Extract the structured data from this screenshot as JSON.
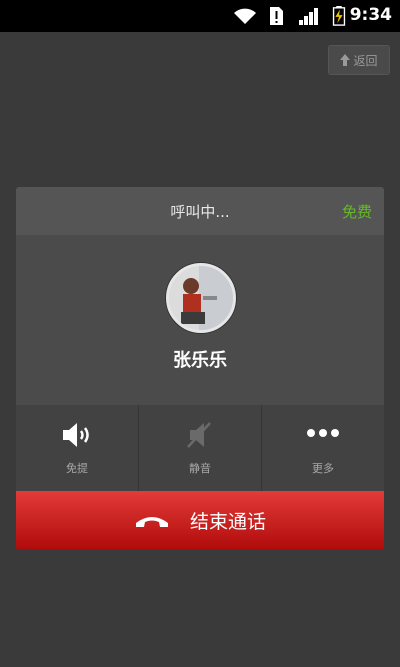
{
  "status_bar": {
    "time": "9:34",
    "icons": [
      "wifi-icon",
      "sim-alert-icon",
      "signal-icon",
      "battery-charging-icon"
    ]
  },
  "back_button": {
    "label": "返回",
    "icon": "arrow-up-icon"
  },
  "call": {
    "status": "呼叫中...",
    "free_label": "免费",
    "contact_name": "张乐乐",
    "end_label": "结束通话"
  },
  "controls": [
    {
      "label": "免提",
      "icon": "speaker-icon"
    },
    {
      "label": "静音",
      "icon": "mute-icon"
    },
    {
      "label": "更多",
      "icon": "more-icon"
    }
  ],
  "colors": {
    "free": "#66b82a",
    "end_button": "#c81e1c"
  }
}
